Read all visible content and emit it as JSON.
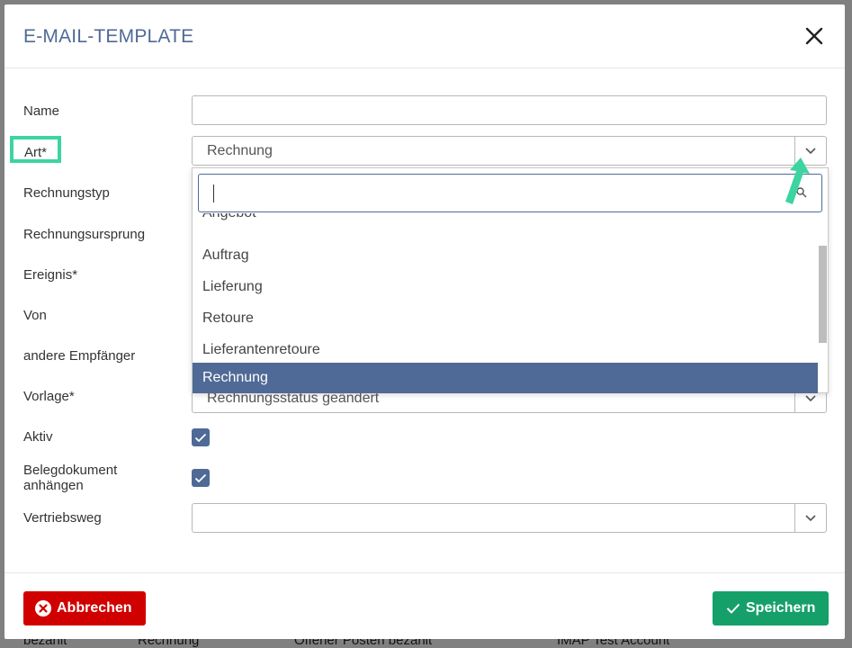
{
  "modal": {
    "title": "E-MAIL-TEMPLATE"
  },
  "form": {
    "name_label": "Name",
    "name_value": "",
    "art_label": "Art*",
    "art_value": "Rechnung",
    "rechnungstyp_label": "Rechnungstyp",
    "rechnungsursprung_label": "Rechnungsursprung",
    "ereignis_label": "Ereignis*",
    "von_label": "Von",
    "andere_empfaenger_label": "andere Empfänger",
    "vorlage_label": "Vorlage*",
    "vorlage_value": "Rechnungsstatus geändert",
    "aktiv_label": "Aktiv",
    "aktiv_checked": true,
    "belegdokument_label_1": "Belegdokument",
    "belegdokument_label_2": "anhängen",
    "belegdokument_checked": true,
    "vertriebsweg_label": "Vertriebsweg",
    "vertriebsweg_value": ""
  },
  "dropdown": {
    "search_value": "",
    "options": [
      "Angebot",
      "Auftrag",
      "Lieferung",
      "Retoure",
      "Lieferantenretoure",
      "Rechnung"
    ],
    "selected": "Rechnung"
  },
  "buttons": {
    "cancel_label": "Abbrechen",
    "save_label": "Speichern"
  },
  "background": {
    "row_cells": [
      "bezahlt",
      "Rechnung",
      "Offener Posten bezahlt",
      "IMAP Test Account"
    ]
  },
  "colors": {
    "primary": "#4f6a96",
    "danger": "#d10000",
    "success": "#15a06a",
    "highlight": "#3cd4a0"
  },
  "icons": {
    "close": "close-icon",
    "chevron": "chevron-down-icon",
    "check": "check-icon",
    "cancel": "x-circle-icon",
    "arrow": "arrow-annotation-icon"
  }
}
